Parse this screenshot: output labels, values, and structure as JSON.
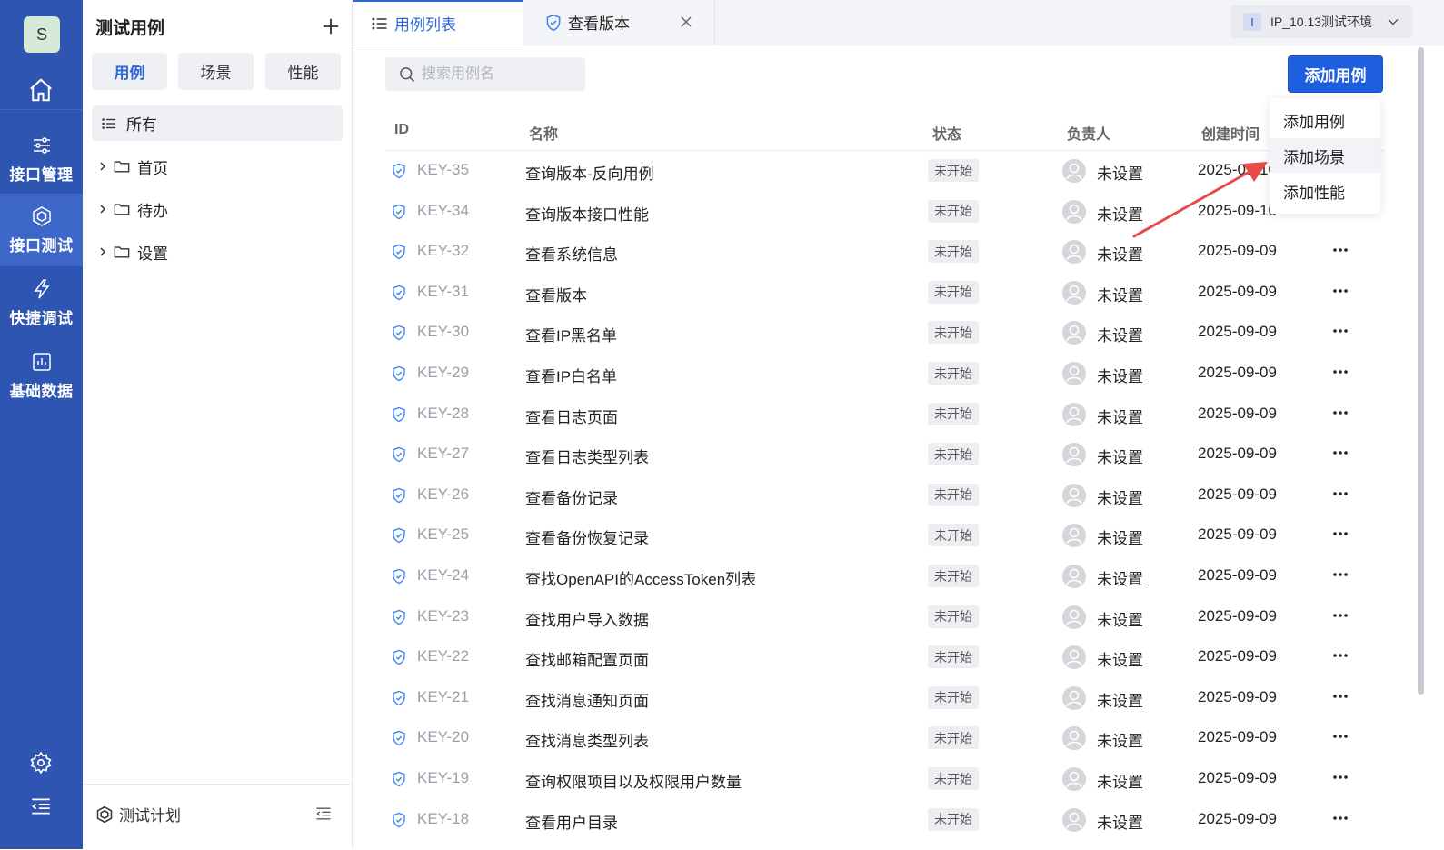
{
  "nav": {
    "user_initial": "S",
    "items": [
      {
        "label": "接口管理",
        "icon": "sliders-icon"
      },
      {
        "label": "接口测试",
        "icon": "cube-icon",
        "active": true
      },
      {
        "label": "快捷调试",
        "icon": "lightning-icon"
      },
      {
        "label": "基础数据",
        "icon": "chart-icon"
      }
    ]
  },
  "sidebar": {
    "title": "测试用例",
    "tabs": [
      "用例",
      "场景",
      "性能"
    ],
    "active_tab": 0,
    "all_label": "所有",
    "tree": [
      "首页",
      "待办",
      "设置"
    ],
    "bottom_label": "测试计划"
  },
  "tabs": [
    {
      "label": "用例列表",
      "active": true
    },
    {
      "label": "查看版本",
      "closable": true
    }
  ],
  "env": {
    "badge": "I",
    "label": "IP_10.13测试环境"
  },
  "search": {
    "placeholder": "搜索用例名",
    "value": ""
  },
  "add_button": "添加用例",
  "dropdown": [
    "添加用例",
    "添加场景",
    "添加性能"
  ],
  "dropdown_hover_index": 1,
  "table": {
    "headers": [
      "ID",
      "名称",
      "状态",
      "负责人",
      "创建时间"
    ],
    "rows": [
      {
        "id": "KEY-35",
        "name": "查询版本-反向用例",
        "status": "未开始",
        "owner": "未设置",
        "date": "2025-09-10"
      },
      {
        "id": "KEY-34",
        "name": "查询版本接口性能",
        "status": "未开始",
        "owner": "未设置",
        "date": "2025-09-10"
      },
      {
        "id": "KEY-32",
        "name": "查看系统信息",
        "status": "未开始",
        "owner": "未设置",
        "date": "2025-09-09"
      },
      {
        "id": "KEY-31",
        "name": "查看版本",
        "status": "未开始",
        "owner": "未设置",
        "date": "2025-09-09"
      },
      {
        "id": "KEY-30",
        "name": "查看IP黑名单",
        "status": "未开始",
        "owner": "未设置",
        "date": "2025-09-09"
      },
      {
        "id": "KEY-29",
        "name": "查看IP白名单",
        "status": "未开始",
        "owner": "未设置",
        "date": "2025-09-09"
      },
      {
        "id": "KEY-28",
        "name": "查看日志页面",
        "status": "未开始",
        "owner": "未设置",
        "date": "2025-09-09"
      },
      {
        "id": "KEY-27",
        "name": "查看日志类型列表",
        "status": "未开始",
        "owner": "未设置",
        "date": "2025-09-09"
      },
      {
        "id": "KEY-26",
        "name": "查看备份记录",
        "status": "未开始",
        "owner": "未设置",
        "date": "2025-09-09"
      },
      {
        "id": "KEY-25",
        "name": "查看备份恢复记录",
        "status": "未开始",
        "owner": "未设置",
        "date": "2025-09-09"
      },
      {
        "id": "KEY-24",
        "name": "查找OpenAPI的AccessToken列表",
        "status": "未开始",
        "owner": "未设置",
        "date": "2025-09-09"
      },
      {
        "id": "KEY-23",
        "name": "查找用户导入数据",
        "status": "未开始",
        "owner": "未设置",
        "date": "2025-09-09"
      },
      {
        "id": "KEY-22",
        "name": "查找邮箱配置页面",
        "status": "未开始",
        "owner": "未设置",
        "date": "2025-09-09"
      },
      {
        "id": "KEY-21",
        "name": "查找消息通知页面",
        "status": "未开始",
        "owner": "未设置",
        "date": "2025-09-09"
      },
      {
        "id": "KEY-20",
        "name": "查找消息类型列表",
        "status": "未开始",
        "owner": "未设置",
        "date": "2025-09-09"
      },
      {
        "id": "KEY-19",
        "name": "查询权限项目以及权限用户数量",
        "status": "未开始",
        "owner": "未设置",
        "date": "2025-09-09"
      },
      {
        "id": "KEY-18",
        "name": "查看用户目录",
        "status": "未开始",
        "owner": "未设置",
        "date": "2025-09-09"
      }
    ]
  },
  "colors": {
    "nav_bg": "#2f55b3",
    "accent": "#1e5fe0",
    "annotation_arrow": "#e84a4a"
  }
}
